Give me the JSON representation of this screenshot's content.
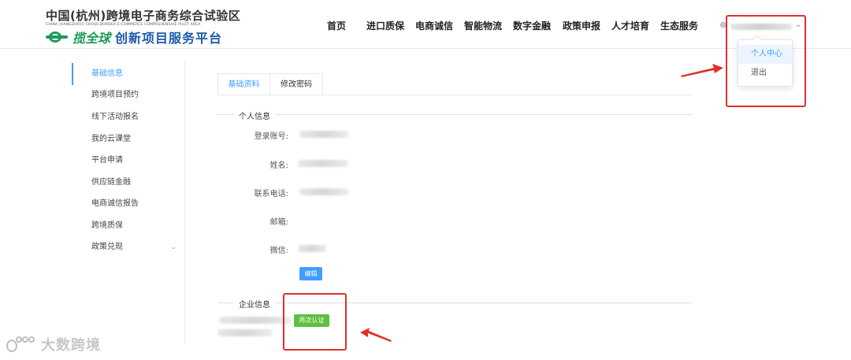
{
  "header": {
    "title": "中国(杭州)跨境电子商务综合试验区",
    "subtitle": "CHINA (HANGZHOU) CROSS-BORDER E-COMMERCE COMPREHENSIVE PILOT AREA",
    "brand_a": "揽全球",
    "brand_b": "创新项目服务平台",
    "nav": [
      "首页",
      "进口质保",
      "电商诚信",
      "智能物流",
      "数字金融",
      "政策申报",
      "人才培育",
      "生态服务"
    ],
    "user_icon": "user-icon",
    "caret_icon": "chevron-down-icon"
  },
  "user_menu": {
    "items": [
      "个人中心",
      "退出"
    ],
    "active_index": 0
  },
  "sidebar": {
    "items": [
      "基础信息",
      "跨境项目预约",
      "线下活动报名",
      "我的云课堂",
      "平台申请",
      "供应链金融",
      "电商诚信报告",
      "跨境质保",
      "政策兑现"
    ],
    "active_index": 0
  },
  "tabs": [
    "基础资料",
    "修改密码"
  ],
  "personal": {
    "section_title": "个人信息",
    "fields": [
      {
        "label": "登录账号:"
      },
      {
        "label": "姓名:"
      },
      {
        "label": "联系电话:"
      },
      {
        "label": "邮箱:"
      },
      {
        "label": "微信:"
      }
    ],
    "edit_label": "编辑"
  },
  "company": {
    "section_title": "企业信息",
    "reverify_label": "再次认证"
  },
  "watermark": {
    "text": "大数跨境"
  },
  "colors": {
    "primary": "#409eff",
    "success": "#5fbf3f",
    "annotation_red": "#e0302a",
    "brand_green": "#1d9a5a",
    "brand_blue": "#1b5aa8"
  }
}
